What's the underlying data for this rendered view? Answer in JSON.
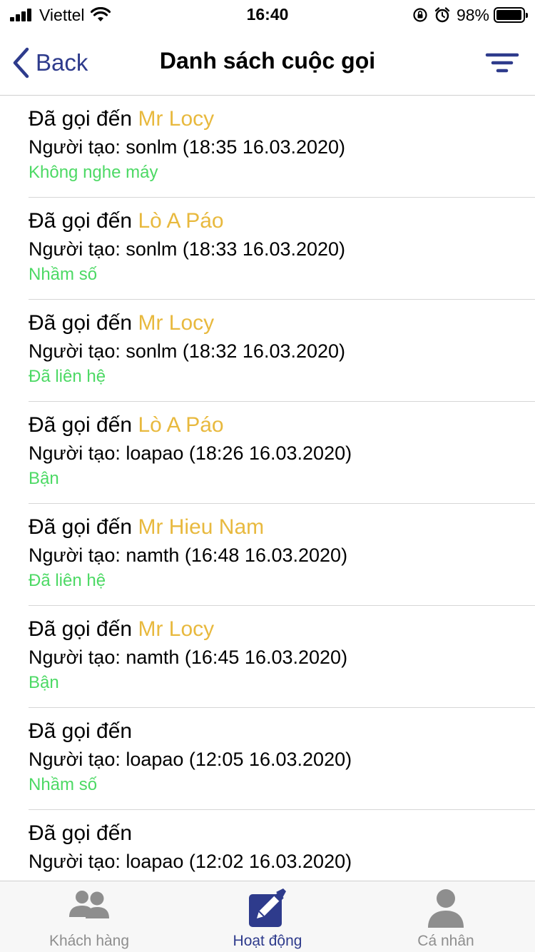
{
  "status_bar": {
    "carrier": "Viettel",
    "time": "16:40",
    "battery": "98%",
    "battery_level": 0.98
  },
  "nav": {
    "back_label": "Back",
    "title": "Danh sách cuộc gọi"
  },
  "calls": [
    {
      "prefix": "Đã gọi đến",
      "target": "Mr Locy",
      "creator": "Người tạo: sonlm (18:35 16.03.2020)",
      "status": "Không nghe máy"
    },
    {
      "prefix": "Đã gọi đến",
      "target": "Lò A Páo",
      "creator": "Người tạo: sonlm (18:33 16.03.2020)",
      "status": "Nhầm số"
    },
    {
      "prefix": "Đã gọi đến",
      "target": "Mr Locy",
      "creator": "Người tạo: sonlm (18:32 16.03.2020)",
      "status": "Đã liên hệ"
    },
    {
      "prefix": "Đã gọi đến",
      "target": "Lò A Páo",
      "creator": "Người tạo: loapao (18:26 16.03.2020)",
      "status": "Bận"
    },
    {
      "prefix": "Đã gọi đến",
      "target": "Mr Hieu Nam",
      "creator": "Người tạo: namth (16:48 16.03.2020)",
      "status": "Đã liên hệ"
    },
    {
      "prefix": "Đã gọi đến",
      "target": "Mr Locy",
      "creator": "Người tạo: namth (16:45 16.03.2020)",
      "status": "Bận"
    },
    {
      "prefix": "Đã gọi đến",
      "target": "",
      "creator": "Người tạo: loapao (12:05 16.03.2020)",
      "status": "Nhầm số"
    },
    {
      "prefix": "Đã gọi đến",
      "target": "",
      "creator": "Người tạo: loapao (12:02 16.03.2020)",
      "status": ""
    }
  ],
  "tabs": [
    {
      "label": "Khách hàng",
      "icon": "customers-icon",
      "active": false
    },
    {
      "label": "Hoạt động",
      "icon": "activity-edit-icon",
      "active": true
    },
    {
      "label": "Cá nhân",
      "icon": "person-icon",
      "active": false
    }
  ],
  "colors": {
    "accent": "#2e3b8c",
    "target_name": "#e8b93e",
    "status_green": "#4cd964",
    "inactive_tab": "#8e8e8e"
  }
}
